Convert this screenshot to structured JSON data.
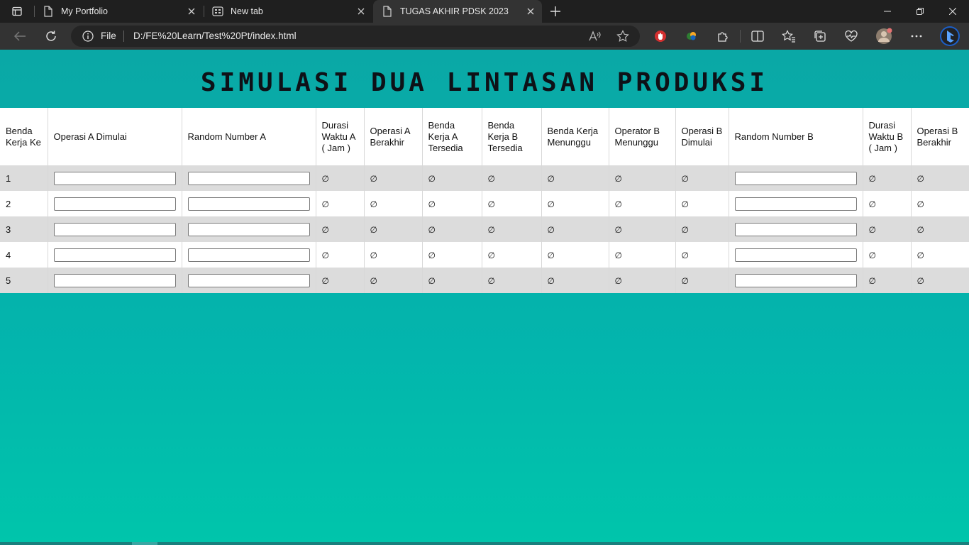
{
  "browser": {
    "tabs": [
      {
        "label": "My Portfolio",
        "icon": "page-icon",
        "active": false
      },
      {
        "label": "New tab",
        "icon": "newtab-icon",
        "active": false
      },
      {
        "label": "TUGAS AKHIR PDSK 2023",
        "icon": "page-icon",
        "active": true
      }
    ],
    "address": {
      "scheme_label": "File",
      "url": "D:/FE%20Learn/Test%20Pt/index.html"
    }
  },
  "page": {
    "title": "SIMULASI DUA LINTASAN PRODUKSI",
    "columns": [
      "Benda Kerja Ke",
      "Operasi A Dimulai",
      "Random Number A",
      "Durasi Waktu A ( Jam )",
      "Operasi A Berakhir",
      "Benda Kerja A Tersedia",
      "Benda Kerja B Tersedia",
      "Benda Kerja Menunggu",
      "Operator B Menunggu",
      "Operasi B Dimulai",
      "Random Number B",
      "Durasi Waktu B ( Jam )",
      "Operasi B Berakhir"
    ],
    "empty_symbol": "∅",
    "rows": [
      {
        "no": "1"
      },
      {
        "no": "2"
      },
      {
        "no": "3"
      },
      {
        "no": "4"
      },
      {
        "no": "5"
      }
    ]
  }
}
